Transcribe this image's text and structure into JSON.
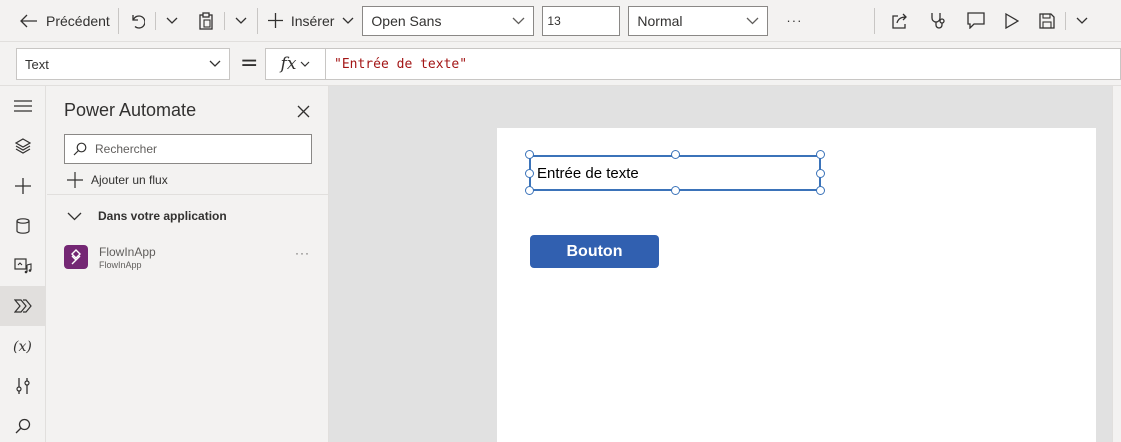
{
  "toolbar": {
    "back_label": "Précédent",
    "insert_label": "Insérer",
    "font_family": "Open Sans",
    "font_size": "13",
    "font_weight": "Normal",
    "more_label": "···"
  },
  "formula": {
    "property": "Text",
    "equals": "=",
    "fx_label": "fx",
    "value": "\"Entrée de texte\""
  },
  "panel": {
    "title": "Power Automate",
    "search_placeholder": "Rechercher",
    "add_flow_label": "Ajouter un flux",
    "section_label": "Dans votre application",
    "flows": [
      {
        "name": "FlowInApp",
        "subtitle": "FlowInApp",
        "more": "···"
      }
    ]
  },
  "canvas": {
    "text_input_value": "Entrée de texte",
    "button_label": "Bouton"
  },
  "colors": {
    "accent": "#3b73b9",
    "button": "#3160b0",
    "flow_icon": "#742774",
    "formula_text": "#a31515"
  }
}
